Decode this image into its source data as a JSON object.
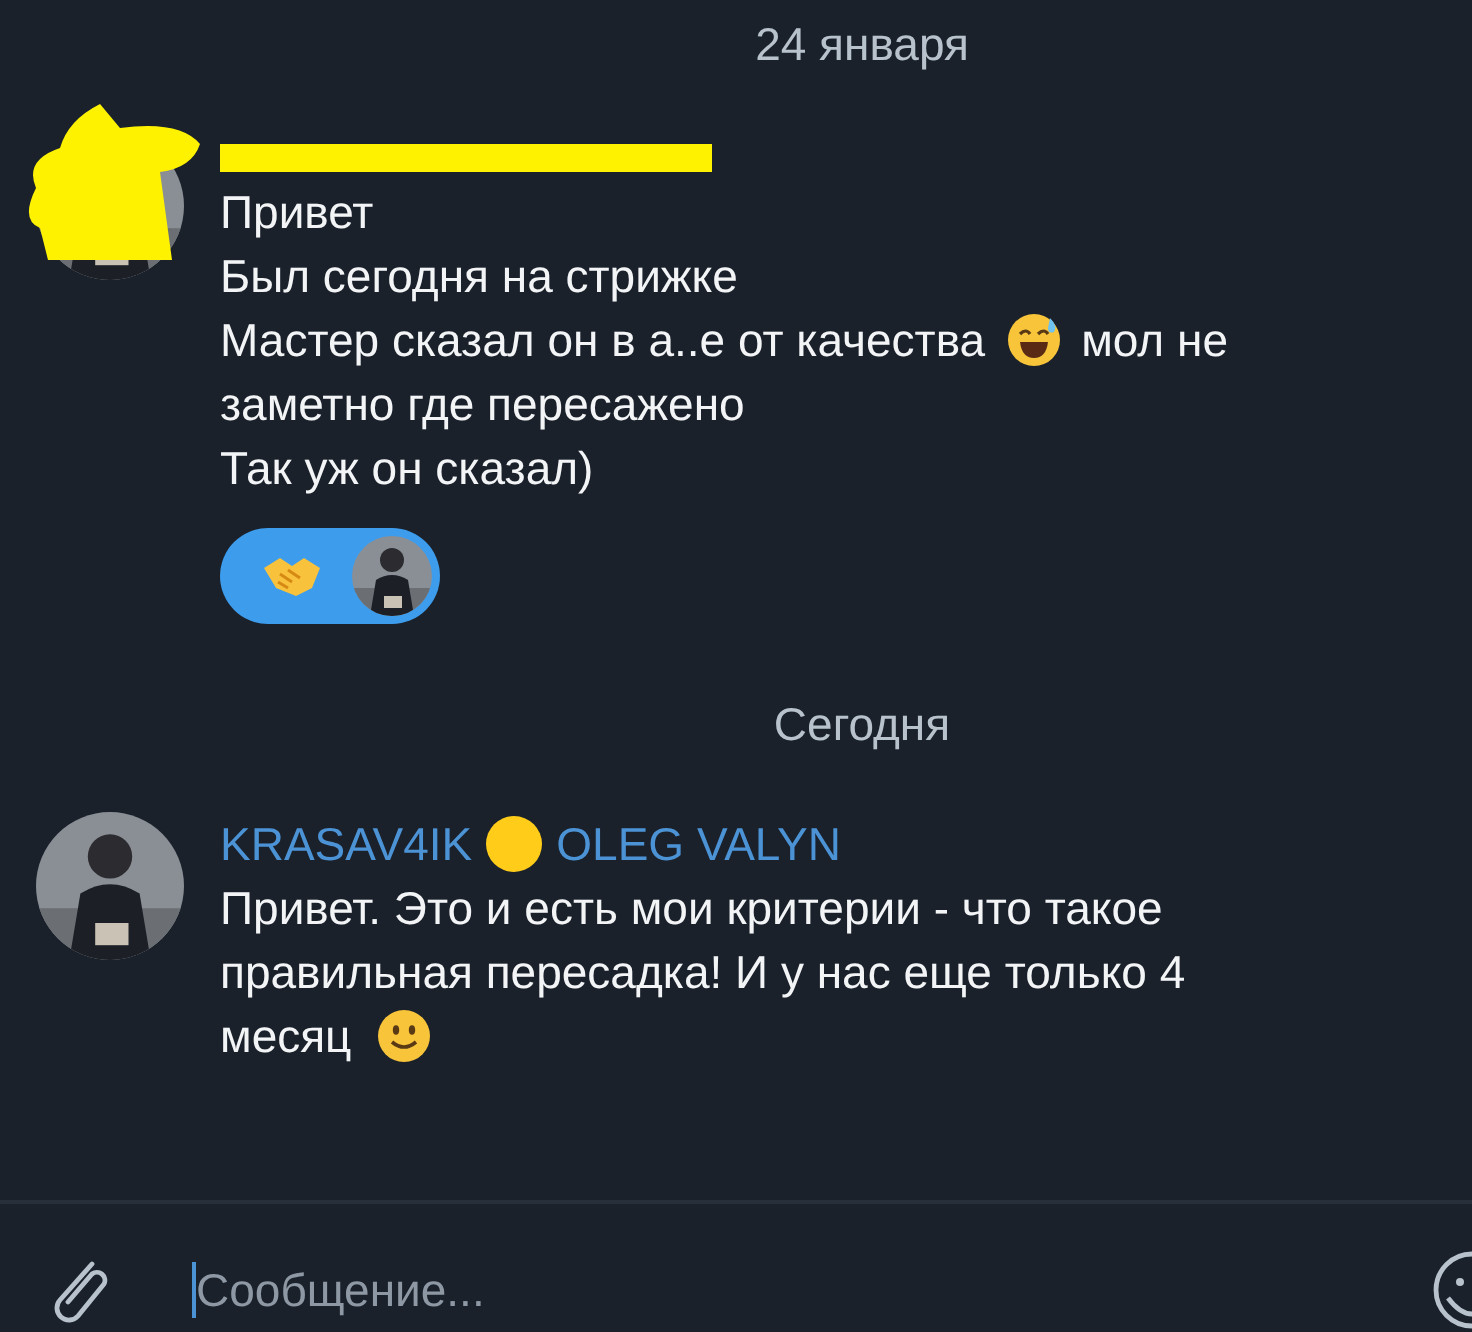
{
  "messages": [
    {
      "kind": "date",
      "text": "24 января"
    },
    {
      "kind": "message",
      "redacted": true,
      "lines": [
        [
          {
            "kind": "text",
            "text": "Привет"
          }
        ],
        [
          {
            "kind": "text",
            "text": "Был сегодня на стрижке"
          }
        ],
        [
          {
            "kind": "text",
            "text": "Мастер сказал он в а..е от качества"
          },
          {
            "kind": "sweat"
          },
          {
            "kind": "text",
            "text": "мол не"
          }
        ],
        [
          {
            "kind": "text",
            "text": "заметно где пересажено"
          }
        ],
        [
          {
            "kind": "text",
            "text": "Так уж он сказал)"
          }
        ]
      ],
      "reaction": {
        "selected": true
      }
    },
    {
      "kind": "date",
      "text": "Сегодня"
    },
    {
      "kind": "message",
      "redacted": false,
      "sender": "KRASAV4IK",
      "sender_suffix": "OLEG VALYN",
      "lines": [
        [
          {
            "kind": "text",
            "text": "Привет. Это и есть мои критерии - что такое"
          }
        ],
        [
          {
            "kind": "text",
            "text": "правильная пересадка! И у нас еще только 4"
          }
        ],
        [
          {
            "kind": "text",
            "text": "месяц"
          },
          {
            "kind": "smile"
          }
        ]
      ]
    }
  ],
  "composer": {
    "placeholder": "Сообщение..."
  }
}
